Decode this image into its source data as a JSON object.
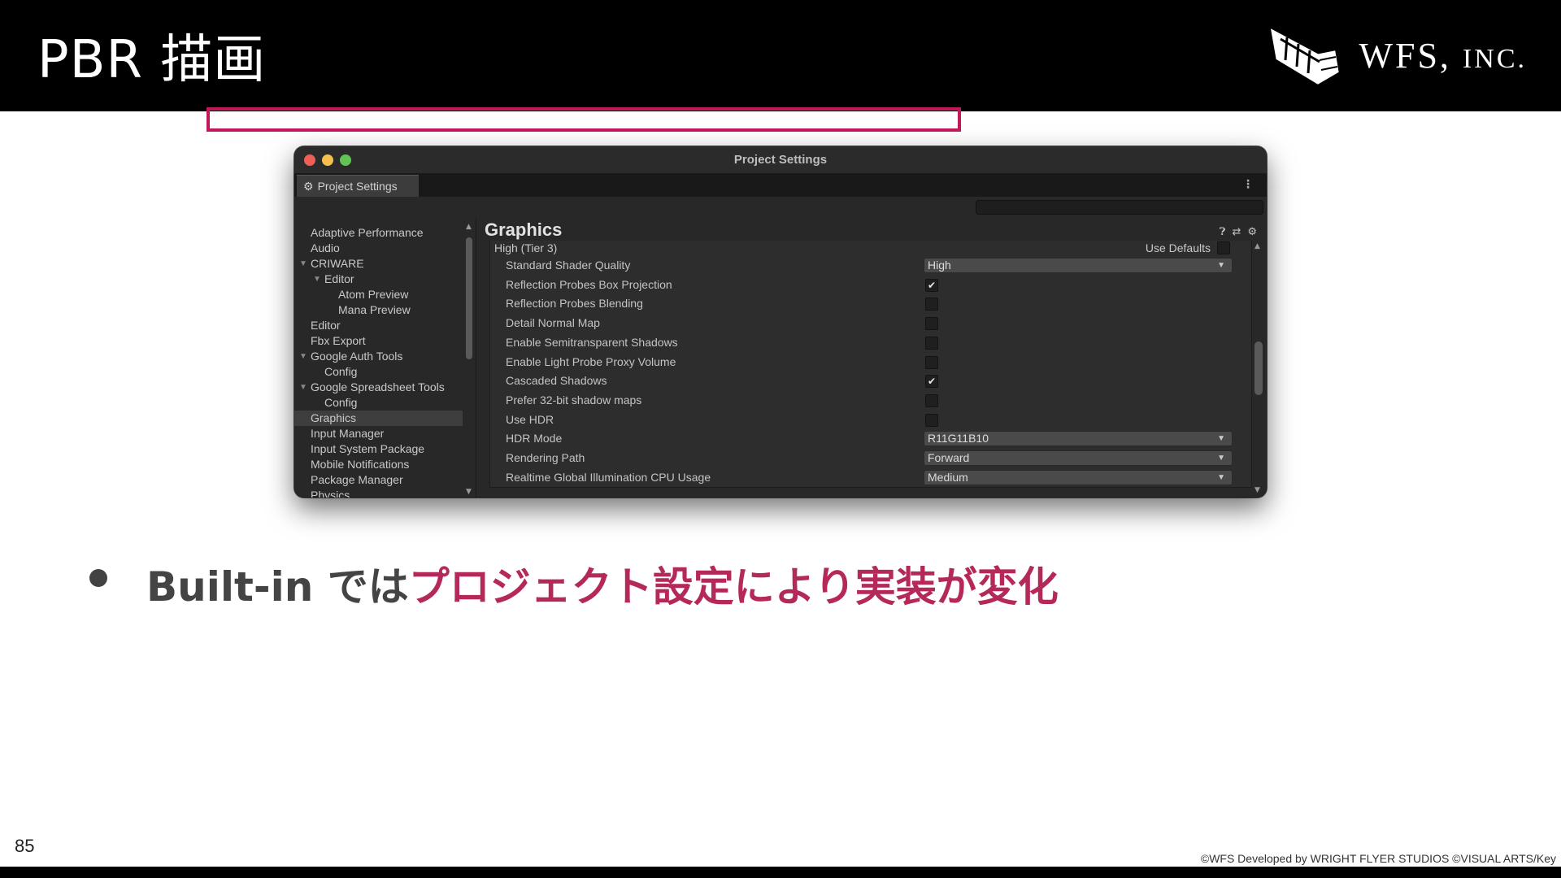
{
  "slide": {
    "title": "PBR 描画",
    "logo_text_main": "WFS,",
    "logo_text_sc": "INC.",
    "page_number": "85",
    "copyright": "©WFS Developed by WRIGHT FLYER STUDIOS ©VISUAL ARTS/Key"
  },
  "window": {
    "title": "Project Settings",
    "tab_label": "Project Settings",
    "search_placeholder": ""
  },
  "sidebar": {
    "items": [
      {
        "label": "Adaptive Performance",
        "indent": 0,
        "arrow": false,
        "selected": false
      },
      {
        "label": "Audio",
        "indent": 0,
        "arrow": false,
        "selected": false
      },
      {
        "label": "CRIWARE",
        "indent": 0,
        "arrow": true,
        "selected": false
      },
      {
        "label": "Editor",
        "indent": 1,
        "arrow": true,
        "selected": false
      },
      {
        "label": "Atom Preview",
        "indent": 2,
        "arrow": false,
        "selected": false
      },
      {
        "label": "Mana Preview",
        "indent": 2,
        "arrow": false,
        "selected": false
      },
      {
        "label": "Editor",
        "indent": 0,
        "arrow": false,
        "selected": false
      },
      {
        "label": "Fbx Export",
        "indent": 0,
        "arrow": false,
        "selected": false
      },
      {
        "label": "Google Auth Tools",
        "indent": 0,
        "arrow": true,
        "selected": false
      },
      {
        "label": "Config",
        "indent": 1,
        "arrow": false,
        "selected": false
      },
      {
        "label": "Google Spreadsheet Tools",
        "indent": 0,
        "arrow": true,
        "selected": false
      },
      {
        "label": "Config",
        "indent": 1,
        "arrow": false,
        "selected": false
      },
      {
        "label": "Graphics",
        "indent": 0,
        "arrow": false,
        "selected": true
      },
      {
        "label": "Input Manager",
        "indent": 0,
        "arrow": false,
        "selected": false
      },
      {
        "label": "Input System Package",
        "indent": 0,
        "arrow": false,
        "selected": false
      },
      {
        "label": "Mobile Notifications",
        "indent": 0,
        "arrow": false,
        "selected": false
      },
      {
        "label": "Package Manager",
        "indent": 0,
        "arrow": false,
        "selected": false
      },
      {
        "label": "Physics",
        "indent": 0,
        "arrow": false,
        "selected": false
      }
    ]
  },
  "main": {
    "title": "Graphics",
    "tier_label": "High (Tier 3)",
    "use_defaults_label": "Use Defaults",
    "properties": [
      {
        "label": "Standard Shader Quality",
        "kind": "dropdown",
        "value": "High"
      },
      {
        "label": "Reflection Probes Box Projection",
        "kind": "checkbox",
        "checked": true
      },
      {
        "label": "Reflection Probes Blending",
        "kind": "checkbox",
        "checked": false
      },
      {
        "label": "Detail Normal Map",
        "kind": "checkbox",
        "checked": false
      },
      {
        "label": "Enable Semitransparent Shadows",
        "kind": "checkbox",
        "checked": false
      },
      {
        "label": "Enable Light Probe Proxy Volume",
        "kind": "checkbox",
        "checked": false
      },
      {
        "label": "Cascaded Shadows",
        "kind": "checkbox",
        "checked": true
      },
      {
        "label": "Prefer 32-bit shadow maps",
        "kind": "checkbox",
        "checked": false
      },
      {
        "label": "Use HDR",
        "kind": "checkbox",
        "checked": false
      },
      {
        "label": "HDR Mode",
        "kind": "dropdown",
        "value": "R11G11B10"
      },
      {
        "label": "Rendering Path",
        "kind": "dropdown",
        "value": "Forward"
      },
      {
        "label": "Realtime Global Illumination CPU Usage",
        "kind": "dropdown",
        "value": "Medium"
      }
    ]
  },
  "bullet": {
    "text_dark": "Built-in では",
    "text_accent": "プロジェクト設定により実装が変化"
  },
  "colors": {
    "highlight": "#c2185b",
    "accent_text": "#b5285a"
  },
  "icons": {
    "tab_icon": "gear-icon",
    "check_glyph": "✔",
    "caret_glyph": "▼",
    "arrow_glyph": "▼"
  }
}
